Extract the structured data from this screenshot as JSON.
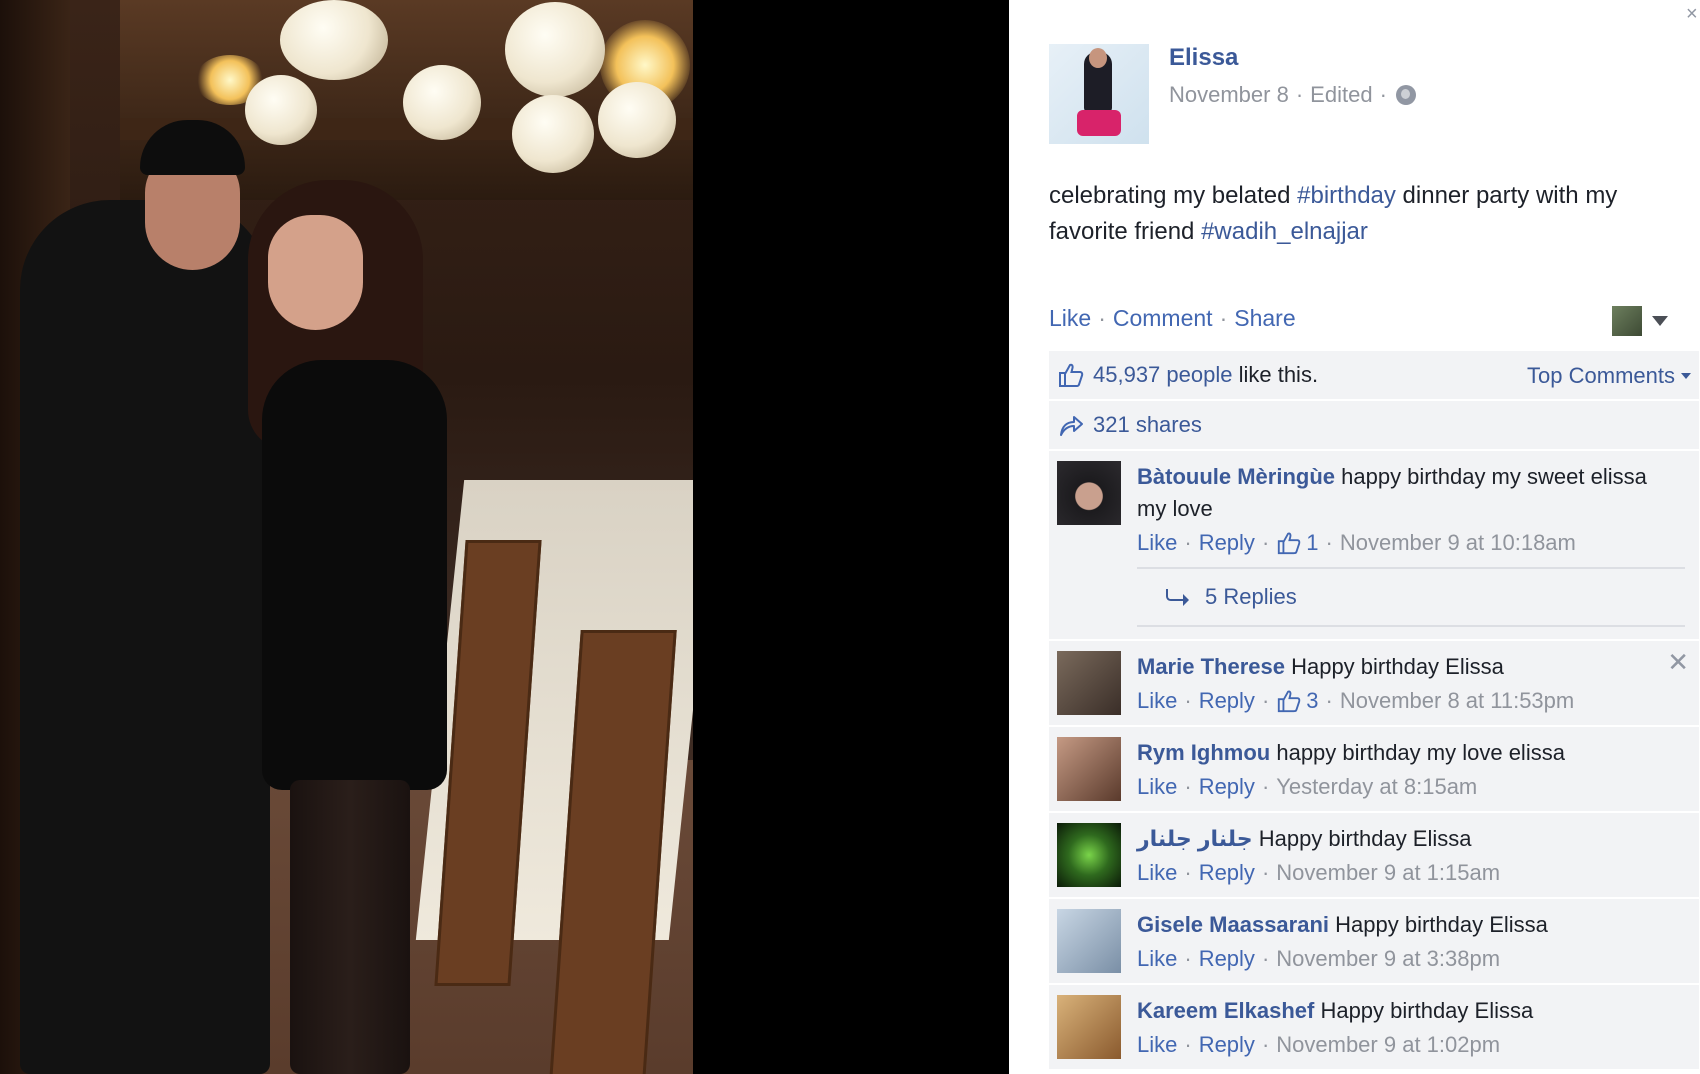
{
  "post": {
    "author": "Elissa",
    "date": "November 8",
    "edited": "Edited",
    "separator": "·",
    "text_parts": [
      {
        "text": "celebrating my belated ",
        "link": false
      },
      {
        "text": "#birthday",
        "link": true
      },
      {
        "text": " dinner party with my favorite friend ",
        "link": false
      },
      {
        "text": "#wadih_elnajjar",
        "link": true
      }
    ]
  },
  "actions": {
    "like": "Like",
    "comment": "Comment",
    "share": "Share",
    "dot": "·"
  },
  "stats": {
    "likes_link": "45,937 people",
    "likes_suffix": " like this.",
    "top_comments": "Top Comments",
    "shares": "321 shares"
  },
  "comments": [
    {
      "author": "Bàtouule Mèringùe",
      "text": " happy birthday my sweet elissa my love",
      "like": "Like",
      "reply": "Reply",
      "likes": "1",
      "time": "November 9 at 10:18am",
      "replies": "5 Replies",
      "avatar_color": "#2c2a2e"
    },
    {
      "author": "Marie Therese",
      "text": " Happy birthday Elissa",
      "like": "Like",
      "reply": "Reply",
      "likes": "3",
      "time": "November 8 at 11:53pm",
      "avatar_color": "#5a4a40",
      "has_close": true
    },
    {
      "author": "Rym Ighmou",
      "text": " happy birthday my love elissa",
      "like": "Like",
      "reply": "Reply",
      "time": "Yesterday at 8:15am",
      "avatar_color": "#8a5a4a"
    },
    {
      "author": "جلنار جلنار",
      "text": " Happy birthday Elissa",
      "like": "Like",
      "reply": "Reply",
      "time": "November 9 at 1:15am",
      "avatar_color": "#2f6a1e"
    },
    {
      "author": "Gisele Maassarani",
      "text": " Happy birthday Elissa",
      "like": "Like",
      "reply": "Reply",
      "time": "November 9 at 3:38pm",
      "avatar_color": "#9ab0c8"
    },
    {
      "author": "Kareem Elkashef",
      "text": " Happy birthday Elissa",
      "like": "Like",
      "reply": "Reply",
      "time": "November 9 at 1:02pm",
      "avatar_color": "#b08a58"
    }
  ],
  "colors": {
    "link_blue": "#3b5998",
    "meta_gray": "#90949c",
    "ufi_bg": "#f2f3f5"
  }
}
